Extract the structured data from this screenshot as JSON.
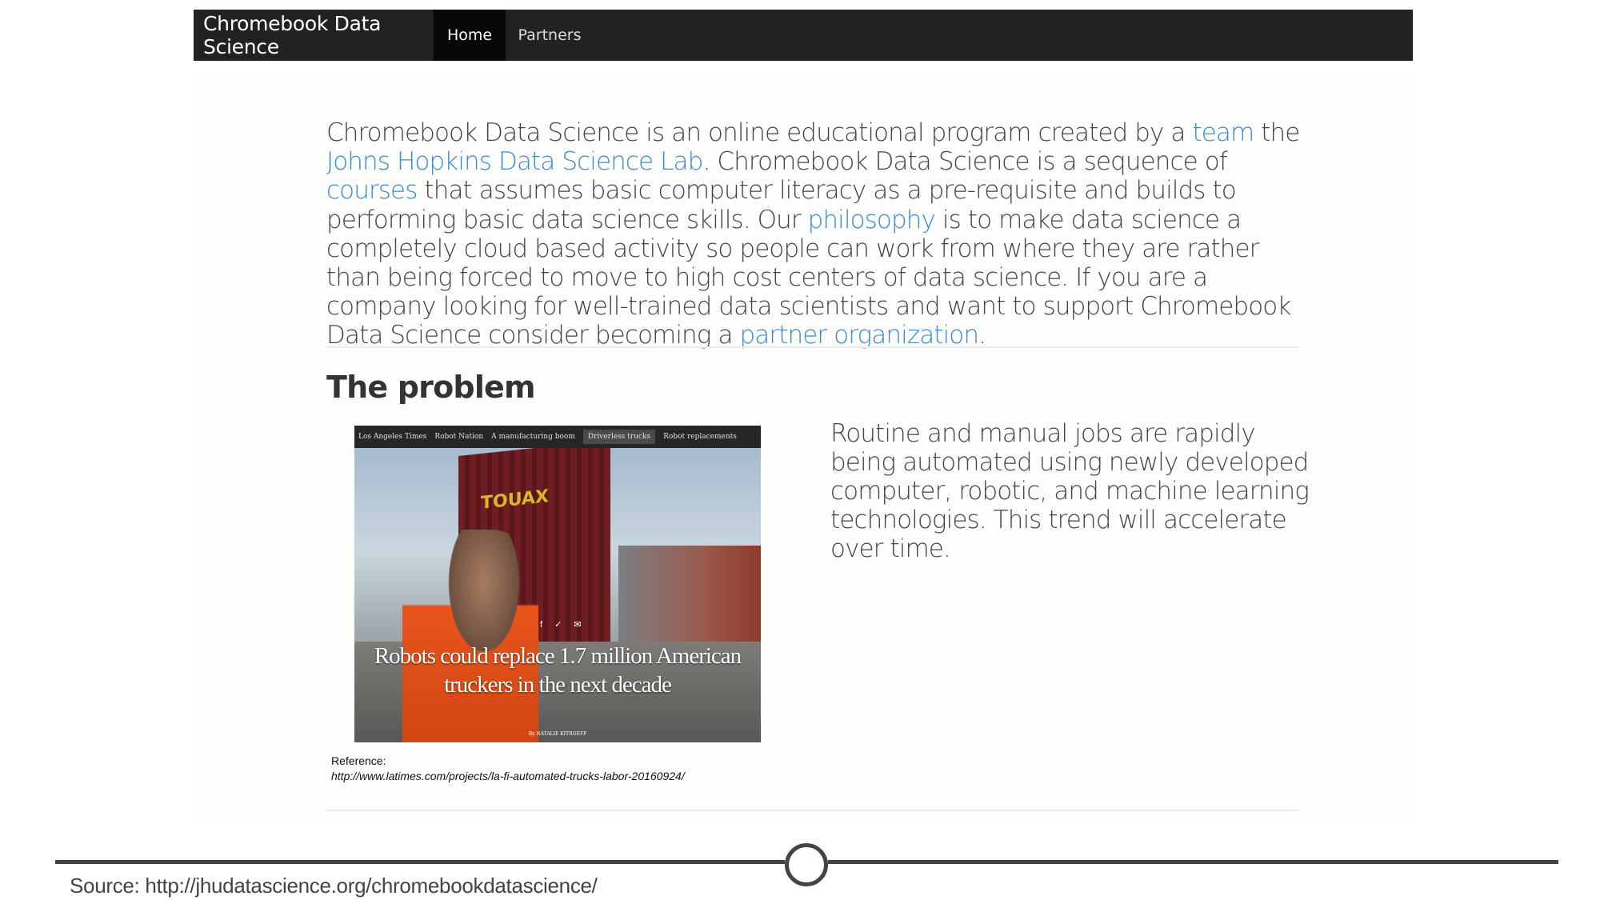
{
  "navbar": {
    "brand": "Chromebook Data Science",
    "items": [
      {
        "label": "Home",
        "active": true
      },
      {
        "label": "Partners",
        "active": false
      }
    ]
  },
  "intro": {
    "t1": "Chromebook Data Science is an online educational program created by a ",
    "link_team": "team",
    "t2": " the ",
    "link_lab": "Johns Hopkins Data Science Lab",
    "t3": ". Chromebook Data Science is a sequence of ",
    "link_courses": "courses",
    "t4": " that assumes basic computer literacy as a pre-requisite and builds to performing basic data science skills. Our ",
    "link_philosophy": "philosophy",
    "t5": " is to make data science a completely cloud based activity so people can work from where they are rather than being forced to move to high cost centers of data science. If you are a company looking for well-trained data scientists and want to support Chromebook Data Science consider becoming a ",
    "link_partner": "partner organization",
    "t6": "."
  },
  "problem": {
    "heading": "The problem",
    "image": {
      "topbar": [
        "Los Angeles Times",
        "Robot Nation",
        "A manufacturing boom",
        "Driverless trucks",
        "Robot replacements"
      ],
      "container_text": "TOUAX",
      "caption": "Robots could replace 1.7 million American truckers in the next decade",
      "byline": "By NATALIE KITROEFF",
      "social_icons": "f ✓ ✉"
    },
    "reference_label": "Reference:",
    "reference_url": "http://www.latimes.com/projects/la-fi-automated-trucks-labor-20160924/",
    "text": "Routine and manual jobs are rapidly being automated using newly developed computer, robotic, and machine learning technologies. This trend will accelerate over time."
  },
  "footer": {
    "source": "Source: http://jhudatascience.org/chromebookdatascience/"
  },
  "colors": {
    "navbar_bg": "#222222",
    "link": "#3b8bd0",
    "text": "#444444"
  }
}
